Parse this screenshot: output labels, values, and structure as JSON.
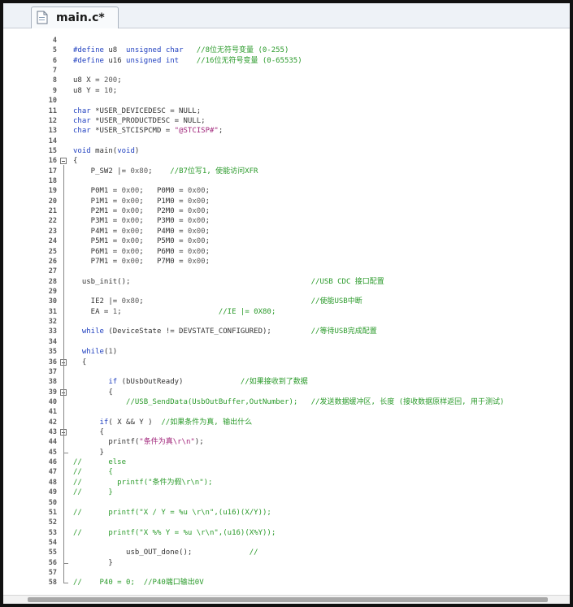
{
  "tab": {
    "label": "main.c*",
    "icon": "c-file-icon"
  },
  "lines": [
    {
      "n": "4",
      "code": ""
    },
    {
      "n": "5",
      "code": "#define u8  unsigned char   //8位无符号变量 (0-255)"
    },
    {
      "n": "6",
      "code": "#define u16 unsigned int    //16位无符号变量 (0-65535)"
    },
    {
      "n": "7",
      "code": ""
    },
    {
      "n": "8",
      "code": "u8 X = 200;"
    },
    {
      "n": "9",
      "code": "u8 Y = 10;"
    },
    {
      "n": "10",
      "code": ""
    },
    {
      "n": "11",
      "code": "char *USER_DEVICEDESC = NULL;"
    },
    {
      "n": "12",
      "code": "char *USER_PRODUCTDESC = NULL;"
    },
    {
      "n": "13",
      "code": "char *USER_STCISPCMD = \"@STCISP#\";"
    },
    {
      "n": "14",
      "code": ""
    },
    {
      "n": "15",
      "code": "void main(void)"
    },
    {
      "n": "16",
      "code": "{",
      "fold": "open"
    },
    {
      "n": "17",
      "code": "    P_SW2 |= 0x80;    //B7位写1, 使能访问XFR"
    },
    {
      "n": "18",
      "code": ""
    },
    {
      "n": "19",
      "code": "    P0M1 = 0x00;   P0M0 = 0x00;"
    },
    {
      "n": "20",
      "code": "    P1M1 = 0x00;   P1M0 = 0x00;"
    },
    {
      "n": "21",
      "code": "    P2M1 = 0x00;   P2M0 = 0x00;"
    },
    {
      "n": "22",
      "code": "    P3M1 = 0x00;   P3M0 = 0x00;"
    },
    {
      "n": "23",
      "code": "    P4M1 = 0x00;   P4M0 = 0x00;"
    },
    {
      "n": "24",
      "code": "    P5M1 = 0x00;   P5M0 = 0x00;"
    },
    {
      "n": "25",
      "code": "    P6M1 = 0x00;   P6M0 = 0x00;"
    },
    {
      "n": "26",
      "code": "    P7M1 = 0x00;   P7M0 = 0x00;"
    },
    {
      "n": "27",
      "code": ""
    },
    {
      "n": "28",
      "code": "  usb_init();                                         //USB CDC 接口配置"
    },
    {
      "n": "29",
      "code": ""
    },
    {
      "n": "30",
      "code": "    IE2 |= 0x80;                                      //使能USB中断"
    },
    {
      "n": "31",
      "code": "    EA = 1;                      //IE |= 0X80;"
    },
    {
      "n": "32",
      "code": ""
    },
    {
      "n": "33",
      "code": "  while (DeviceState != DEVSTATE_CONFIGURED);         //等待USB完成配置"
    },
    {
      "n": "34",
      "code": ""
    },
    {
      "n": "35",
      "code": "  while(1)"
    },
    {
      "n": "36",
      "code": "  {",
      "fold": "open"
    },
    {
      "n": "37",
      "code": ""
    },
    {
      "n": "38",
      "code": "        if (bUsbOutReady)             //如果接收到了数据"
    },
    {
      "n": "39",
      "code": "        {",
      "fold": "open"
    },
    {
      "n": "40",
      "code": "            //USB_SendData(UsbOutBuffer,OutNumber);   //发送数据缓冲区, 长度 (接收数据原样返回, 用于测试)"
    },
    {
      "n": "41",
      "code": ""
    },
    {
      "n": "42",
      "code": "      if( X && Y )  //如果条件为真, 输出什么"
    },
    {
      "n": "43",
      "code": "      {",
      "fold": "open"
    },
    {
      "n": "44",
      "code": "        printf(\"条件为真\\r\\n\");"
    },
    {
      "n": "45",
      "code": "      }",
      "fold": "end"
    },
    {
      "n": "46",
      "code": "//      else"
    },
    {
      "n": "47",
      "code": "//      {"
    },
    {
      "n": "48",
      "code": "//        printf(\"条件为假\\r\\n\");"
    },
    {
      "n": "49",
      "code": "//      }"
    },
    {
      "n": "50",
      "code": ""
    },
    {
      "n": "51",
      "code": "//      printf(\"X / Y = %u \\r\\n\",(u16)(X/Y));"
    },
    {
      "n": "52",
      "code": ""
    },
    {
      "n": "53",
      "code": "//      printf(\"X %% Y = %u \\r\\n\",(u16)(X%Y));"
    },
    {
      "n": "54",
      "code": ""
    },
    {
      "n": "55",
      "code": "            usb_OUT_done();             //"
    },
    {
      "n": "56",
      "code": "        }",
      "fold": "end"
    },
    {
      "n": "57",
      "code": ""
    },
    {
      "n": "58",
      "code": "//    P40 = 0;  //P40端口输出0V"
    }
  ],
  "colors": {
    "keyword": "#1f3fbf",
    "comment": "#2a9a2a",
    "string": "#a0247a",
    "text": "#333333",
    "line_number": "#5a5a5a"
  }
}
